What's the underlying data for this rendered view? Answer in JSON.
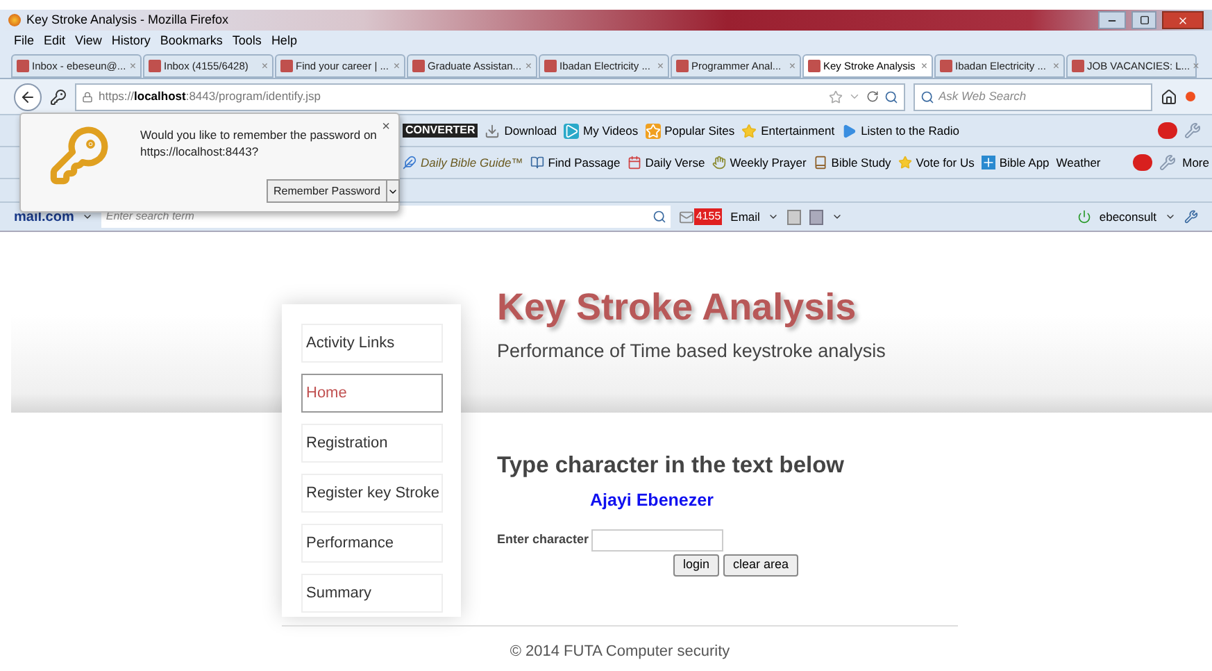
{
  "window": {
    "title": "Key Stroke Analysis - Mozilla Firefox"
  },
  "menu": [
    "File",
    "Edit",
    "View",
    "History",
    "Bookmarks",
    "Tools",
    "Help"
  ],
  "tabs": [
    {
      "label": "Inbox - ebeseun@...",
      "selected": false
    },
    {
      "label": "Inbox (4155/6428)",
      "selected": false
    },
    {
      "label": "Find your career | ...",
      "selected": false
    },
    {
      "label": "Graduate Assistan...",
      "selected": false
    },
    {
      "label": "Ibadan Electricity ...",
      "selected": false
    },
    {
      "label": "Programmer Anal...",
      "selected": false
    },
    {
      "label": "Key Stroke Analysis",
      "selected": true
    },
    {
      "label": "Ibadan Electricity ...",
      "selected": false
    },
    {
      "label": "JOB VACANCIES: L...",
      "selected": false
    }
  ],
  "tab_close": "×",
  "nav": {
    "url": "https://**localhost**:8443/program/identify.jsp",
    "search_placeholder": "Ask Web Search"
  },
  "popup": {
    "message": "Would you like to remember the password on https://localhost:8443?",
    "button": "Remember Password",
    "close": "×"
  },
  "toolbar_1": {
    "logo": "CONVERTER",
    "items": [
      "Download",
      "My Videos",
      "Popular Sites",
      "Entertainment",
      "Listen to the Radio"
    ]
  },
  "toolbar_2": {
    "items": [
      "Daily Bible Guide™",
      "Find Passage",
      "Daily Verse",
      "Weekly Prayer",
      "Bible Study",
      "Vote for Us",
      "Bible App",
      "Weather"
    ],
    "more": "More"
  },
  "mail_bar": {
    "logo": "mail.com",
    "search_placeholder": "Enter search term",
    "badge": "4155",
    "email": "Email",
    "user": "ebeconsult"
  },
  "page": {
    "title": "Key Stroke Analysis",
    "subtitle": "Performance of Time based keystroke analysis",
    "nav": [
      {
        "label": "Activity Links",
        "selected": false
      },
      {
        "label": "Home",
        "selected": true
      },
      {
        "label": "Registration",
        "selected": false
      },
      {
        "label": "Register key Stroke",
        "selected": false
      },
      {
        "label": "Performance",
        "selected": false
      },
      {
        "label": "Summary",
        "selected": false
      }
    ],
    "heading": "Type character in the text below",
    "name": "Ajayi Ebenezer",
    "field_label": "Enter character",
    "buttons": [
      "login",
      "clear area"
    ],
    "footer": "© 2014 FUTA Computer security"
  }
}
